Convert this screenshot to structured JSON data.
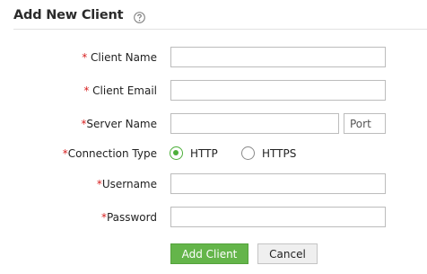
{
  "header": {
    "title": "Add New Client",
    "help_icon": "question-circle-icon"
  },
  "required_marker": "*",
  "form": {
    "client_name": {
      "label": "Client Name",
      "value": ""
    },
    "client_email": {
      "label": "Client Email",
      "value": ""
    },
    "server_name": {
      "label": "Server Name",
      "value": "",
      "port_placeholder": "Port"
    },
    "connection_type": {
      "label": "Connection Type",
      "options": [
        "HTTP",
        "HTTPS"
      ],
      "selected": "HTTP"
    },
    "username": {
      "label": "Username",
      "value": ""
    },
    "password": {
      "label": "Password",
      "value": ""
    }
  },
  "actions": {
    "submit_label": "Add Client",
    "cancel_label": "Cancel"
  },
  "colors": {
    "accent": "#64b54a",
    "required": "#d71f1f"
  }
}
